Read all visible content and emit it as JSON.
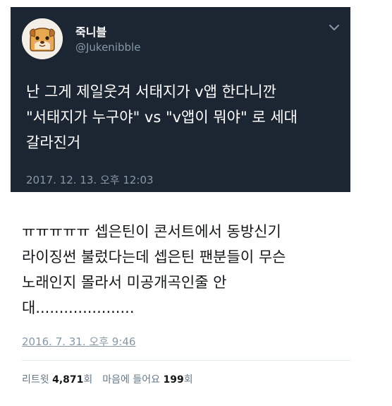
{
  "tweet1": {
    "display_name": "죽니블",
    "handle": "@Jukenibble",
    "text_lines": [
      "난 그게 제일웃겨 서태지가 v앱 한다니깐",
      "\"서태지가 누구야\" vs \"v앱이 뭐야\" 로 세대",
      "갈라진거"
    ],
    "timestamp": "2017. 12. 13. 오후 12:03",
    "icons": {
      "avatar": "avatar-image",
      "menu": "chevron-down-icon"
    },
    "colors": {
      "background": "#1c2532",
      "text": "#ffffff",
      "muted": "#8899a6"
    }
  },
  "tweet2": {
    "text_lines": [
      "ㅠㅠㅠㅠㅠ 셉은틴이 콘서트에서 동방신기",
      "라이징썬 불렀다는데 셉은틴 팬분들이 무슨",
      "노래인지 몰라서 미공개곡인줄 안",
      "대....................."
    ],
    "timestamp": "2016. 7. 31. 오후 9:46",
    "stats": {
      "retweet_label": "리트윗",
      "retweet_count": "4,871",
      "retweet_unit": "회",
      "like_label": "마음에 들어요",
      "like_count": "199",
      "like_unit": "회"
    },
    "colors": {
      "background": "#ffffff",
      "text": "#14171a",
      "muted": "#8899a6"
    }
  }
}
